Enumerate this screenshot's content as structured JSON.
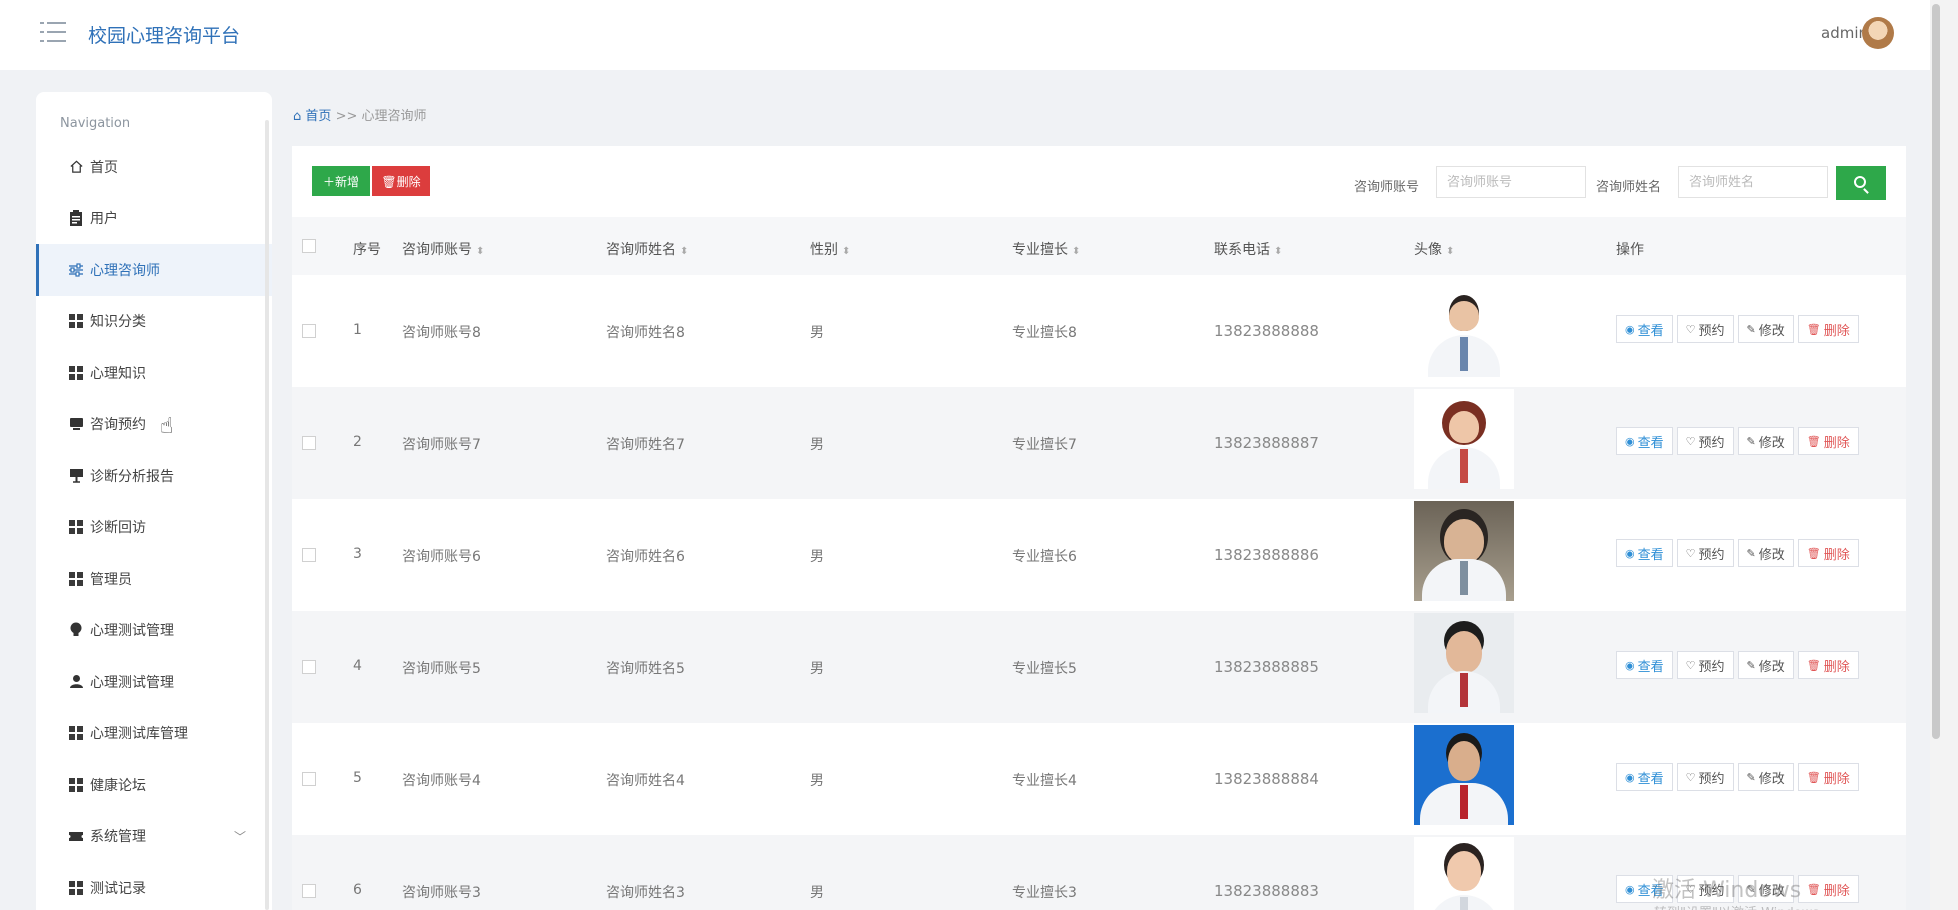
{
  "header": {
    "brand": "校园心理咨询平台",
    "user": "admin"
  },
  "sidebar": {
    "title": "Navigation",
    "items": [
      {
        "label": "首页",
        "icon": "home-icon"
      },
      {
        "label": "用户",
        "icon": "clipboard-icon"
      },
      {
        "label": "心理咨询师",
        "icon": "sliders-icon",
        "active": true
      },
      {
        "label": "知识分类",
        "icon": "grid-icon"
      },
      {
        "label": "心理知识",
        "icon": "grid-icon"
      },
      {
        "label": "咨询预约",
        "icon": "desktop-icon"
      },
      {
        "label": "诊断分析报告",
        "icon": "easel-icon"
      },
      {
        "label": "诊断回访",
        "icon": "grid-icon"
      },
      {
        "label": "管理员",
        "icon": "grid-icon"
      },
      {
        "label": "心理测试管理",
        "icon": "lightbulb-icon"
      },
      {
        "label": "心理测试管理",
        "icon": "user-icon"
      },
      {
        "label": "心理测试库管理",
        "icon": "grid-icon"
      },
      {
        "label": "健康论坛",
        "icon": "grid-icon"
      },
      {
        "label": "系统管理",
        "icon": "ticket-icon",
        "expandable": true
      },
      {
        "label": "测试记录",
        "icon": "grid-icon"
      }
    ]
  },
  "breadcrumb": {
    "home": "首页",
    "separator": ">>",
    "current": "心理咨询师"
  },
  "toolbar": {
    "add_label": "新增",
    "delete_label": "删除",
    "account_label": "咨询师账号",
    "account_placeholder": "咨询师账号",
    "name_label": "咨询师姓名",
    "name_placeholder": "咨询师姓名"
  },
  "table": {
    "columns": [
      "序号",
      "咨询师账号",
      "咨询师姓名",
      "性别",
      "专业擅长",
      "联系电话",
      "头像",
      "操作"
    ],
    "rows": [
      {
        "index": "1",
        "account": "咨询师账号8",
        "name": "咨询师姓名8",
        "gender": "男",
        "specialty": "专业擅长8",
        "phone": "13823888888"
      },
      {
        "index": "2",
        "account": "咨询师账号7",
        "name": "咨询师姓名7",
        "gender": "男",
        "specialty": "专业擅长7",
        "phone": "13823888887"
      },
      {
        "index": "3",
        "account": "咨询师账号6",
        "name": "咨询师姓名6",
        "gender": "男",
        "specialty": "专业擅长6",
        "phone": "13823888886"
      },
      {
        "index": "4",
        "account": "咨询师账号5",
        "name": "咨询师姓名5",
        "gender": "男",
        "specialty": "专业擅长5",
        "phone": "13823888885"
      },
      {
        "index": "5",
        "account": "咨询师账号4",
        "name": "咨询师姓名4",
        "gender": "男",
        "specialty": "专业擅长4",
        "phone": "13823888884"
      },
      {
        "index": "6",
        "account": "咨询师账号3",
        "name": "咨询师姓名3",
        "gender": "男",
        "specialty": "专业擅长3",
        "phone": "13823888883"
      }
    ],
    "actions": {
      "view": "查看",
      "book": "预约",
      "edit": "修改",
      "remove": "删除"
    }
  },
  "watermark": {
    "line1": "激活 Windows",
    "line2": "转到\"设置\"以激活 Windows。"
  },
  "colors": {
    "primary": "#2f71b8",
    "success": "#2ea84a",
    "danger": "#dc3d3d"
  }
}
